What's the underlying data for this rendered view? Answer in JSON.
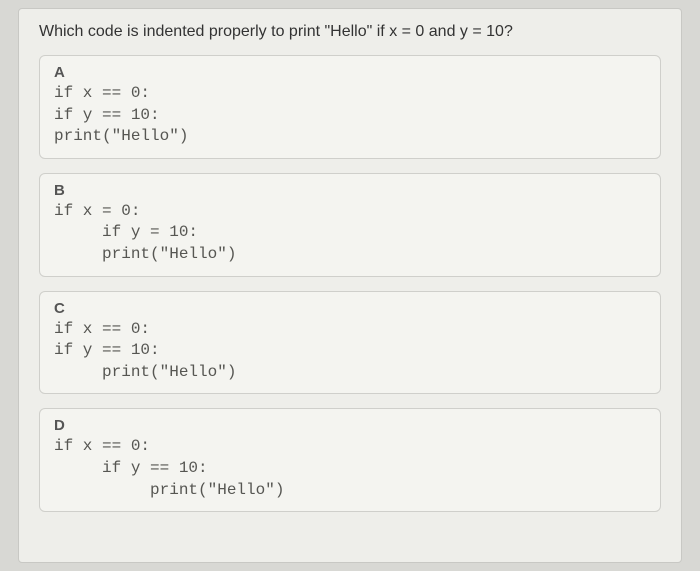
{
  "question": "Which code is indented properly to print \"Hello\" if x = 0 and y = 10?",
  "options": {
    "a": {
      "label": "A",
      "code": "if x == 0:\nif y == 10:\nprint(\"Hello\")"
    },
    "b": {
      "label": "B",
      "code": "if x = 0:\n     if y = 10:\n     print(\"Hello\")"
    },
    "c": {
      "label": "C",
      "code": "if x == 0:\nif y == 10:\n     print(\"Hello\")"
    },
    "d": {
      "label": "D",
      "code": "if x == 0:\n     if y == 10:\n          print(\"Hello\")"
    }
  }
}
